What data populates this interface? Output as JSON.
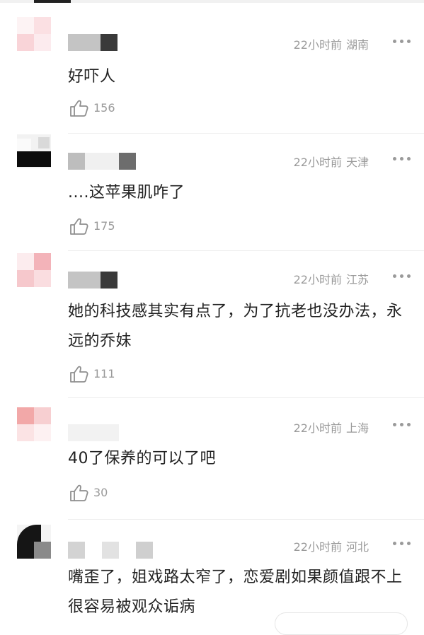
{
  "comments": [
    {
      "time": "22小时前",
      "region": "湖南",
      "text": "好吓人",
      "likes": "156"
    },
    {
      "time": "22小时前",
      "region": "天津",
      "text": "....这苹果肌咋了",
      "likes": "175"
    },
    {
      "time": "22小时前",
      "region": "江苏",
      "text": "她的科技感其实有点了，为了抗老也没办法，永远的乔妹",
      "likes": "111"
    },
    {
      "time": "22小时前",
      "region": "上海",
      "text": "40了保养的可以了吧",
      "likes": "30"
    },
    {
      "time": "22小时前",
      "region": "河北",
      "text": "嘴歪了，姐戏路太窄了，恋爱剧如果颜值跟不上很容易被观众诟病",
      "likes": ""
    }
  ],
  "colors": {
    "meta_gray": "#9a9a9a",
    "text": "#222222",
    "divider": "#eeeeee"
  }
}
